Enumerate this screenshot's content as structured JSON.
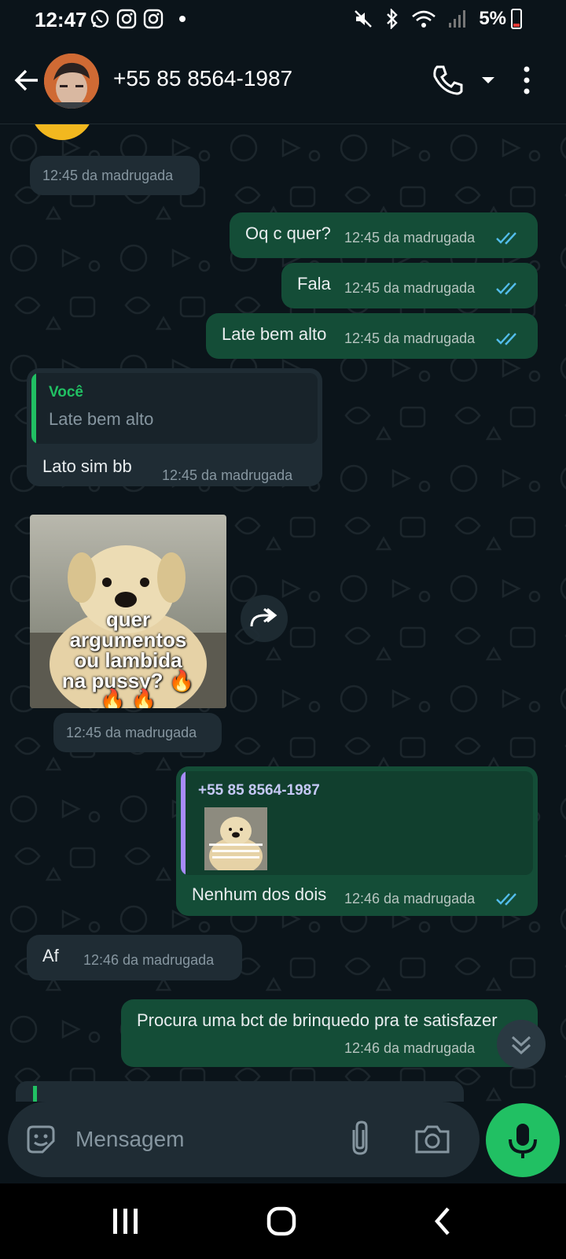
{
  "status_bar": {
    "time": "12:47",
    "battery": "5%",
    "left_icons": [
      "whatsapp-icon",
      "instagram-icon",
      "instagram-icon",
      "dot-icon"
    ],
    "right_icons": [
      "mute-icon",
      "bluetooth-icon",
      "wifi-icon",
      "signal-icon",
      "battery-icon"
    ]
  },
  "header": {
    "contact_name": "+55 85 8564-1987",
    "icons": [
      "back-arrow-icon",
      "avatar",
      "phone-icon",
      "chevron-down-icon",
      "more-vert-icon"
    ]
  },
  "messages": [
    {
      "type": "system",
      "time": "12:45 da madrugada"
    },
    {
      "type": "out",
      "text": "Oq c quer?",
      "time": "12:45 da madrugada",
      "status": "read"
    },
    {
      "type": "out",
      "text": "Fala",
      "time": "12:45 da madrugada",
      "status": "read"
    },
    {
      "type": "out",
      "text": "Late bem alto",
      "time": "12:45 da madrugada",
      "status": "read"
    },
    {
      "type": "in",
      "quote_author": "Você",
      "quote_text": "Late bem alto",
      "text": "Lato sim bb",
      "time": "12:45 da madrugada"
    },
    {
      "type": "in-image",
      "caption_lines": [
        "quer",
        "argumentos",
        "ou lambida",
        "na pussy? 🔥",
        "🔥 🔥"
      ],
      "time": "12:45 da madrugada"
    },
    {
      "type": "out",
      "quote_author": "+55 85 8564-1987",
      "text": "Nenhum dos dois",
      "time": "12:46 da madrugada",
      "status": "read"
    },
    {
      "type": "in",
      "text": "Af",
      "time": "12:46 da madrugada"
    },
    {
      "type": "out",
      "text": "Procura uma bct de brinquedo pra te satisfazer",
      "time": "12:46 da madrugada",
      "status": "sent"
    }
  ],
  "composer": {
    "placeholder": "Mensagem"
  },
  "colors": {
    "background": "#0b141a",
    "outgoing_bubble": "#144d37",
    "incoming_bubble": "#1f2c34",
    "read_ticks": "#53bdeb",
    "accent_green": "#21c063"
  }
}
